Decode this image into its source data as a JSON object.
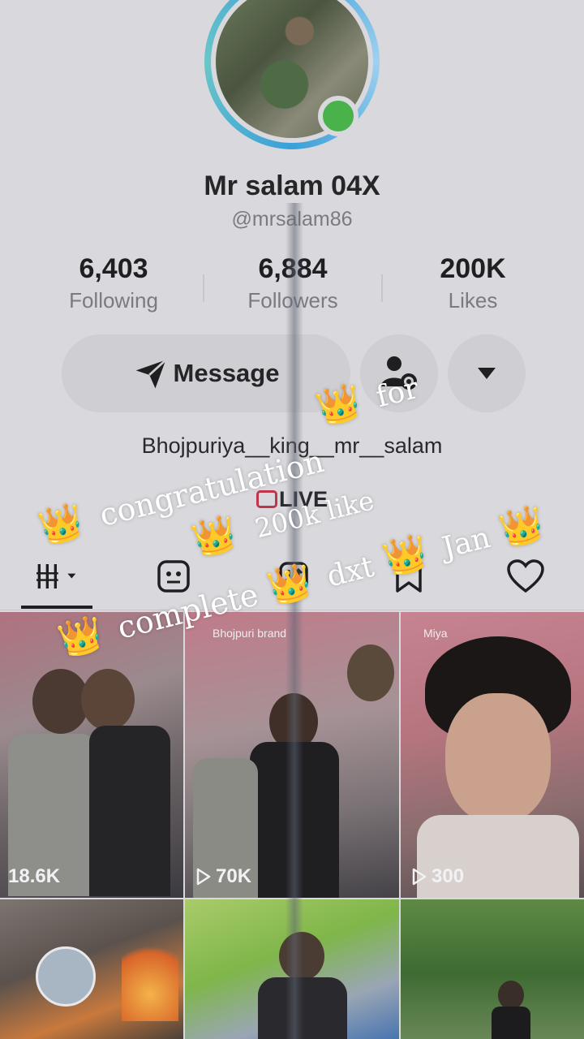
{
  "profile": {
    "name": "Mr salam 04X",
    "handle": "@mrsalam86",
    "bio": "Bhojpuriya__king__mr__salam",
    "live_label": "LIVE"
  },
  "stats": [
    {
      "value": "6,403",
      "label": "Following"
    },
    {
      "value": "6,884",
      "label": "Followers"
    },
    {
      "value": "200K",
      "label": "Likes"
    }
  ],
  "actions": {
    "message_label": "Message"
  },
  "tabs": [
    {
      "icon": "grid-icon",
      "active": true
    },
    {
      "icon": "private-icon"
    },
    {
      "icon": "repost-icon"
    },
    {
      "icon": "bookmark-icon"
    },
    {
      "icon": "heart-icon"
    }
  ],
  "videos": [
    {
      "views": "18.6K",
      "play_icon": false
    },
    {
      "views": "70K",
      "play_icon": true
    },
    {
      "views": "300",
      "play_icon": true
    },
    {
      "views": ""
    },
    {
      "views": ""
    },
    {
      "views": ""
    }
  ],
  "video_captions": {
    "v2": "Bhojpuri brand",
    "v3": "Miya"
  },
  "overlay": {
    "line1_word1": "for",
    "line2_word1": "congratulation",
    "line3_word1": "200k like",
    "line4_word1": "complete",
    "line4_word2": "dxt",
    "line4_word3": "Jan",
    "crown": "👑"
  },
  "colors": {
    "background": "#d9d8dc",
    "online": "#49b24a",
    "ring": "#3aa0d8"
  }
}
